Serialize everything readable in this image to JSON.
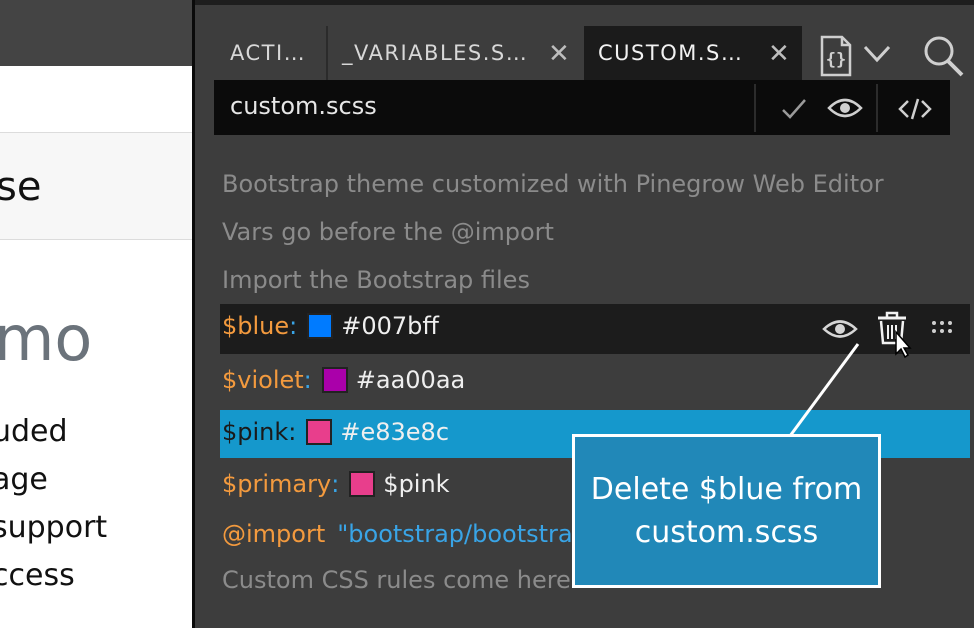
{
  "left_preview": {
    "heading_fragment": "se",
    "demo_fragment": "mo",
    "lines": [
      "uded",
      "age",
      "support",
      "ccess"
    ]
  },
  "tabs": [
    {
      "label": "ACTI…"
    },
    {
      "label": "_VARIABLES.S…"
    },
    {
      "label": "CUSTOM.S…"
    }
  ],
  "file": {
    "name": "custom.scss"
  },
  "comments": [
    "Bootstrap theme customized with Pinegrow Web Editor",
    "Vars go before the @import",
    "Import the Bootstrap files"
  ],
  "variables": [
    {
      "name": "$blue",
      "swatch": "#007bff",
      "value": "#007bff"
    },
    {
      "name": "$violet",
      "swatch": "#aa00aa",
      "value": "#aa00aa"
    },
    {
      "name": "$pink",
      "swatch": "#e83e8c",
      "value": "#e83e8c"
    },
    {
      "name": "$primary",
      "swatch": "#e83e8c",
      "value": "$pink"
    }
  ],
  "import": {
    "keyword": "@import",
    "path": "\"bootstrap/bootstra"
  },
  "last_comment": "Custom CSS rules come here",
  "callout": {
    "text": "Delete $blue from custom.scss"
  },
  "colors": {
    "accent": "#1598cc",
    "var_name": "#f39a3e",
    "punct": "#39a4e6"
  }
}
